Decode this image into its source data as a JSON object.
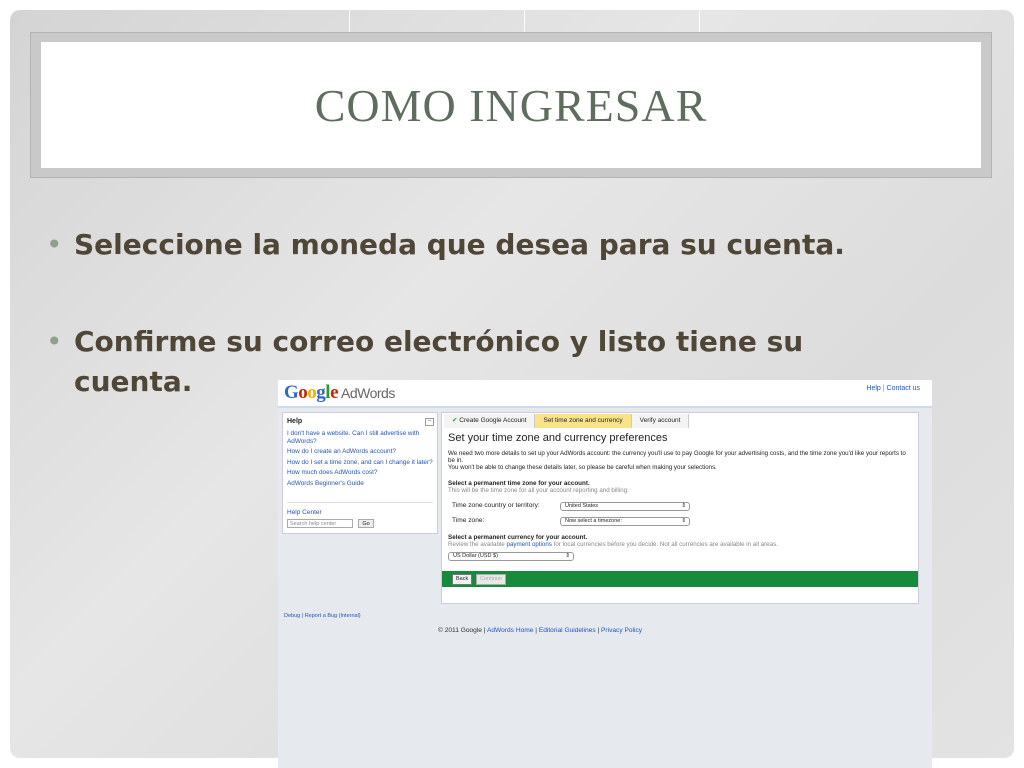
{
  "slide": {
    "title": "COMO INGRESAR",
    "bullets": [
      "Seleccione la moneda que desea para su cuenta.",
      "Confirme su correo electrónico y listo tiene su cuenta."
    ],
    "bullet_marker": "•"
  },
  "screenshot": {
    "logo_word": [
      "G",
      "o",
      "o",
      "g",
      "l",
      "e"
    ],
    "logo_colors": [
      "#3366cc",
      "#cc2200",
      "#f0b000",
      "#3366cc",
      "#2a9a2a",
      "#cc2200"
    ],
    "product": "AdWords",
    "top_links": {
      "help": "Help",
      "separator": "|",
      "contact": "Contact us"
    },
    "help_panel": {
      "title": "Help",
      "collapse": "–",
      "links": [
        "I don't have a website. Can I still advertise with AdWords?",
        "How do I create an AdWords account?",
        "How do I set a time zone, and can I change it later?",
        "How much does AdWords cost?",
        "AdWords Beginner's Guide"
      ],
      "help_center": "Help Center",
      "search_placeholder": "Search help center",
      "go_label": "Go"
    },
    "steps": {
      "check": "✔",
      "create": "Create Google Account",
      "timezone": "Set time zone and currency",
      "verify": "Verify account"
    },
    "panel_title": "Set your time zone and currency preferences",
    "intro_1": "We need two more details to set up your AdWords account: the currency you'll use to pay Google for your advertising costs, and the time zone you'd like your reports to be in.",
    "intro_2": "You won't be able to change these details later, so please be careful when making your selections.",
    "timezone_section": {
      "heading": "Select a permanent time zone for your account.",
      "note": "This will be the time zone for all your account reporting and billing.",
      "country_label": "Time zone country or territory:",
      "country_value": "United States",
      "zone_label": "Time zone:",
      "zone_value": "Now select a timezone:"
    },
    "currency_section": {
      "heading": "Select a permanent currency for your account.",
      "note_before": "Review the available",
      "note_link": "payment options",
      "note_after": "for local currencies before you decide. Not all currencies are available in all areas.",
      "value": "US Dollar (USD $)"
    },
    "select_arrow": "⇕",
    "buttons": {
      "back": "Back",
      "continue": "Continue"
    },
    "debug_links": "Debug | Report a Bug (Internal)",
    "footer": {
      "copyright": "© 2011 Google |",
      "home": "AdWords Home",
      "sep1": "|",
      "guidelines": "Editorial Guidelines",
      "sep2": "|",
      "privacy": "Privacy Policy"
    }
  }
}
